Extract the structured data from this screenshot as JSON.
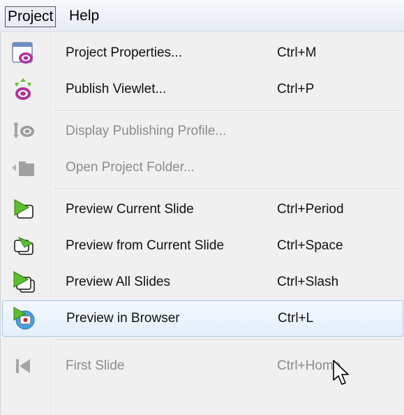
{
  "menubar": {
    "items": [
      {
        "label": "Project"
      },
      {
        "label": "Help"
      }
    ]
  },
  "menu": {
    "items": [
      {
        "label": "Project Properties...",
        "shortcut": "Ctrl+M",
        "icon": "project-properties-icon",
        "enabled": true
      },
      {
        "label": "Publish Viewlet...",
        "shortcut": "Ctrl+P",
        "icon": "publish-viewlet-icon",
        "enabled": true
      },
      {
        "label": "Display Publishing Profile...",
        "shortcut": "",
        "icon": "publishing-profile-icon",
        "enabled": false
      },
      {
        "label": "Open Project Folder...",
        "shortcut": "",
        "icon": "folder-icon",
        "enabled": false
      },
      {
        "label": "Preview Current Slide",
        "shortcut": "Ctrl+Period",
        "icon": "preview-current-slide-icon",
        "enabled": true
      },
      {
        "label": "Preview from Current Slide",
        "shortcut": "Ctrl+Space",
        "icon": "preview-from-slide-icon",
        "enabled": true
      },
      {
        "label": "Preview All Slides",
        "shortcut": "Ctrl+Slash",
        "icon": "preview-all-slides-icon",
        "enabled": true
      },
      {
        "label": "Preview in Browser",
        "shortcut": "Ctrl+L",
        "icon": "preview-browser-icon",
        "enabled": true,
        "hovered": true
      },
      {
        "label": "First Slide",
        "shortcut": "Ctrl+Home",
        "icon": "first-slide-icon",
        "enabled": false
      }
    ]
  },
  "colors": {
    "hover_border": "#a9c7ea",
    "disabled_text": "#8c8c8c",
    "menu_bg": "#f0f0f0",
    "icon_purple": "#b0329c",
    "icon_green": "#5bbf2e"
  }
}
